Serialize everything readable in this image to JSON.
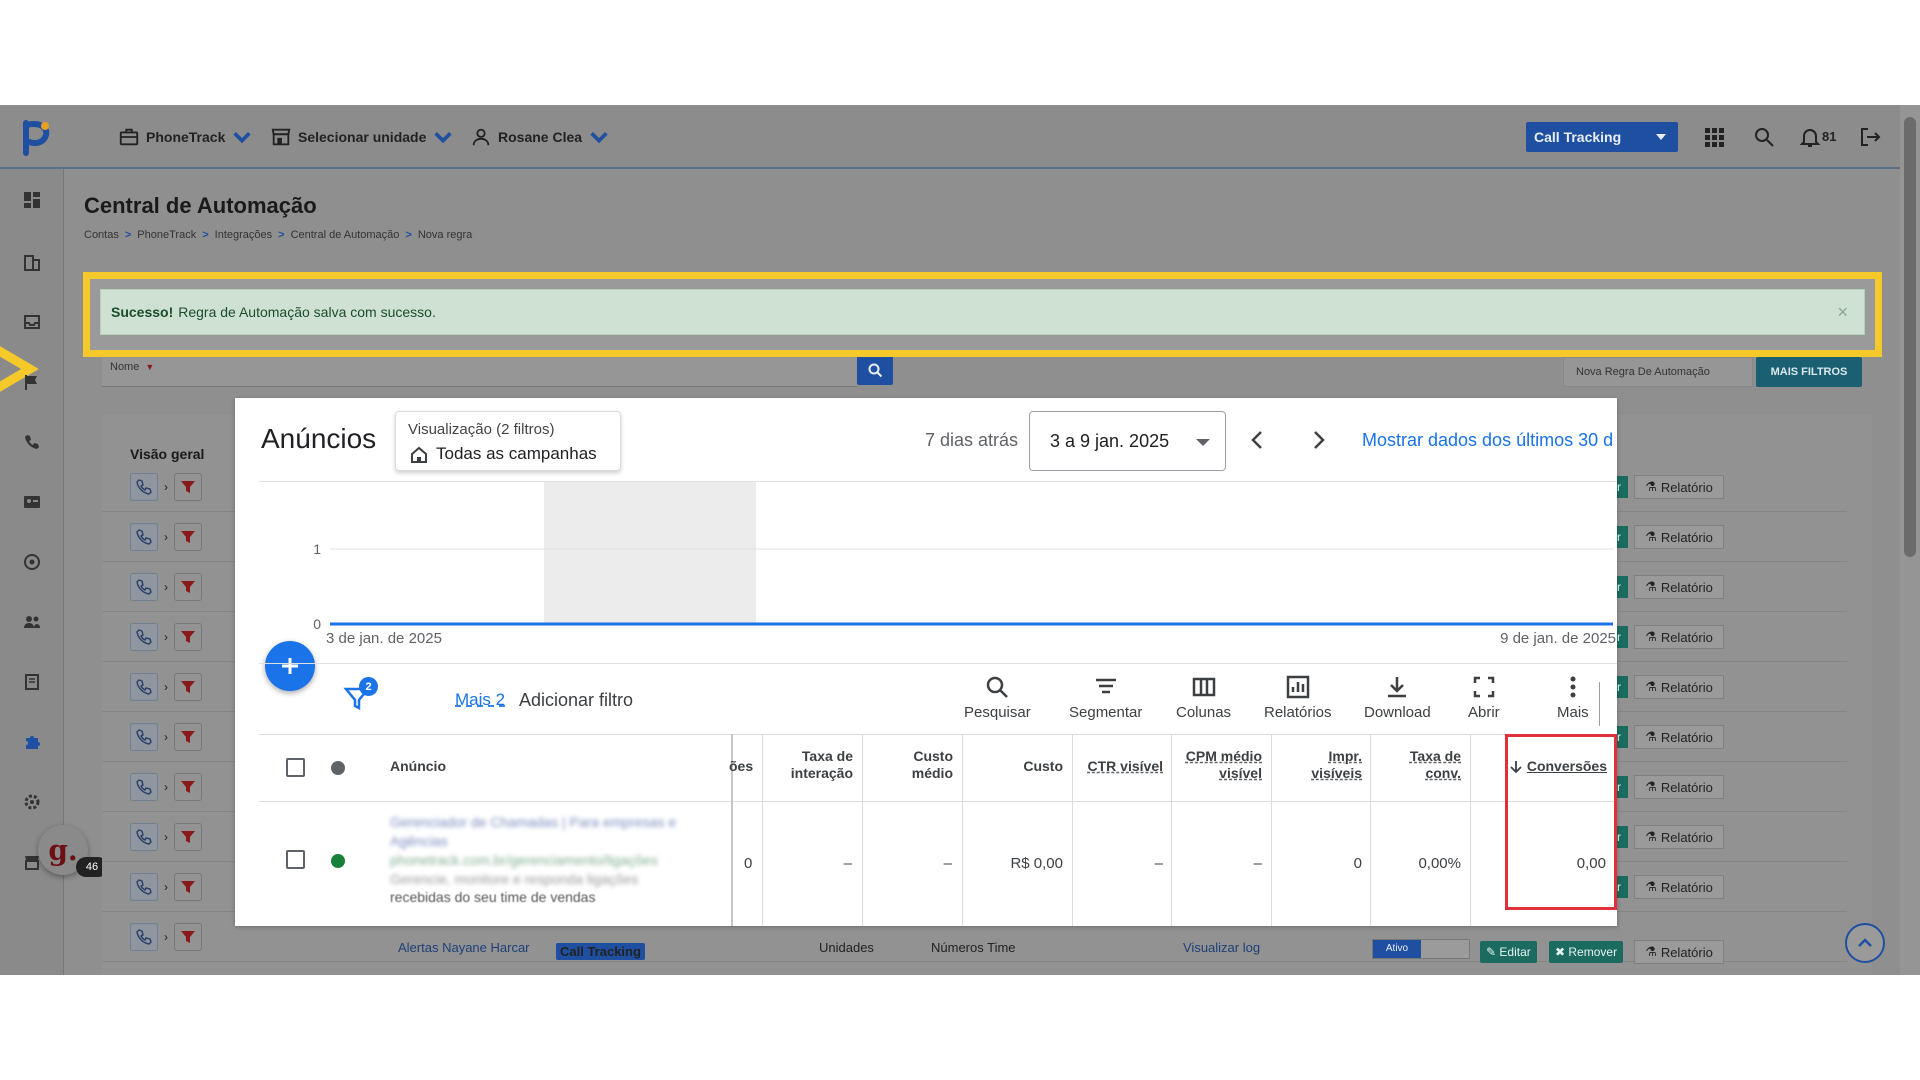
{
  "topbar": {
    "menus": [
      {
        "label": "PhoneTrack",
        "icon": "briefcase-icon"
      },
      {
        "label": "Selecionar unidade",
        "icon": "store-icon"
      },
      {
        "label": "Rosane Clea",
        "icon": "user-icon"
      }
    ],
    "product_select": "Call Tracking",
    "notification_count": "81"
  },
  "sidebar": {
    "icons": [
      "dashboard-icon",
      "building-icon",
      "inbox-icon",
      "flag-icon",
      "phone-icon",
      "contact-card-icon",
      "target-icon",
      "users-icon",
      "book-icon",
      "puzzle-icon",
      "settings-icon",
      "store-icon"
    ],
    "avatar_letter": "g.",
    "avatar_badge": "46"
  },
  "page": {
    "title": "Central de Automação",
    "breadcrumb": [
      "Contas",
      "PhoneTrack",
      "Integrações",
      "Central de Automação",
      "Nova regra"
    ],
    "breadcrumb_sep": ">"
  },
  "alert": {
    "strong": "Sucesso!",
    "message": "Regra de Automação salva com sucesso.",
    "close": "×"
  },
  "filters": {
    "name_label": "Nome",
    "rule_select": "Nova Regra De Automação",
    "more_filters": "MAIS FILTROS"
  },
  "list": {
    "overview_label": "Visão geral",
    "row_count": 10,
    "report_label": "Relatório",
    "last_row": {
      "name": "Alertas Nayane Harcar",
      "badge": "Call Tracking",
      "scope": "Unidades",
      "numbers": "Números Time",
      "log_link": "Visualizar log",
      "status": "Ativo",
      "edit": "Editar",
      "remove": "Remover",
      "report": "Relatório"
    }
  },
  "ads": {
    "title": "Anúncios",
    "view_label": "Visualização (2 filtros)",
    "view_value": "Todas as campanhas",
    "days_ago": "7 dias atrás",
    "date_range": "3 a 9 jan. 2025",
    "show_data_link": "Mostrar dados dos últimos 30 d",
    "filter_badge": "2",
    "more_link": "Mais 2",
    "add_filter": "Adicionar filtro",
    "tools": [
      "Pesquisar",
      "Segmentar",
      "Colunas",
      "Relatórios",
      "Download",
      "Abrir",
      "Mais"
    ],
    "columns": {
      "anuncio": "Anúncio",
      "partial": "ões",
      "taxa_interacao": [
        "Taxa de",
        "interação"
      ],
      "custo_medio": [
        "Custo",
        "médio"
      ],
      "custo": "Custo",
      "ctr_visivel": "CTR visível",
      "cpm_medio_visivel": [
        "CPM médio",
        "visível"
      ],
      "impr_visiveis": [
        "Impr.",
        "visíveis"
      ],
      "taxa_conv": [
        "Taxa de",
        "conv."
      ],
      "conversoes": "Conversões"
    },
    "row": {
      "ad_text_line1": "Gerenciador de Chamadas | Para empresas e",
      "ad_text_line2": "Agências",
      "ad_url": "phonetrack.com.br/gerenciamento/ligações",
      "ad_text_line4": "Gerencie, monitore e responda ligações",
      "ad_text_line5": "recebidas do seu time de vendas",
      "partial": "0",
      "taxa_interacao": "–",
      "custo_medio": "–",
      "custo": "R$ 0,00",
      "ctr_visivel": "–",
      "cpm_medio_visivel": "–",
      "impr_visiveis": "0",
      "taxa_conv": "0,00%",
      "conversoes": "0,00"
    },
    "colors": {
      "accent": "#1a73e8",
      "status_dot": "#188038",
      "highlight": "#e0303a"
    }
  },
  "chart_data": {
    "type": "line",
    "x": [
      "3 de jan. de 2025",
      "9 de jan. de 2025"
    ],
    "series": [
      {
        "values": [
          0,
          0
        ]
      }
    ],
    "yticks": [
      "0",
      "1"
    ],
    "xticks": [
      "3 de jan. de 2025",
      "9 de jan. de 2025"
    ],
    "ylim": [
      0,
      1
    ],
    "grid": true,
    "line_color": "#1a73e8"
  }
}
